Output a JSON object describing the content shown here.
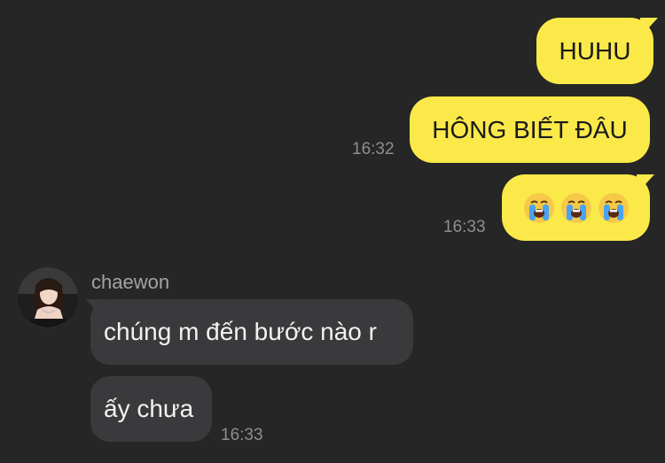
{
  "messages_out": [
    {
      "text": "HUHU"
    },
    {
      "text": "HÔNG BIẾT ĐÂU",
      "time": "16:32"
    },
    {
      "emoji": [
        "crying-face",
        "crying-face",
        "crying-face"
      ],
      "time": "16:33"
    }
  ],
  "sender": {
    "name": "chaewon",
    "avatar": "profile-photo"
  },
  "messages_in": [
    {
      "text": "chúng m đến bước nào r"
    },
    {
      "text": "ấy chưa",
      "time": "16:33"
    }
  ],
  "colors": {
    "background": "#262626",
    "outgoing_bubble": "#fbe94a",
    "incoming_bubble": "#3a3a3c",
    "timestamp": "#8e8e8e"
  }
}
